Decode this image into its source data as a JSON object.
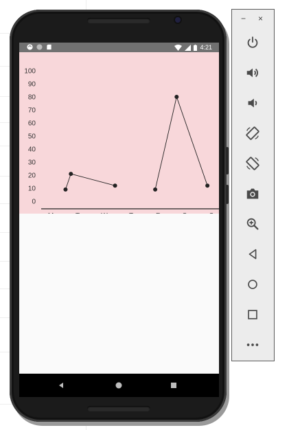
{
  "status_bar": {
    "time": "4:21",
    "left_icons": [
      "sync-icon",
      "circle-icon",
      "sd-card-icon"
    ],
    "right_icons": [
      "wifi-icon",
      "signal-icon",
      "battery-icon"
    ]
  },
  "chart_data": {
    "type": "line",
    "categories": [
      "M",
      "T",
      "W",
      "T",
      "F",
      "S",
      "S"
    ],
    "y_ticks": [
      "0",
      "10",
      "20",
      "30",
      "40",
      "50",
      "60",
      "70",
      "80",
      "90",
      "100"
    ],
    "ylim": [
      0,
      100
    ],
    "segments": [
      [
        [
          0.55,
          9
        ],
        [
          0.75,
          21
        ],
        [
          2.4,
          12
        ]
      ],
      [
        [
          3.9,
          9
        ],
        [
          4.7,
          80
        ],
        [
          5.85,
          12
        ]
      ]
    ],
    "background_color": "#f8d7da",
    "line_color": "#222222"
  },
  "nav_bar": {
    "buttons": [
      "back-icon",
      "home-icon",
      "recents-icon"
    ]
  },
  "emulator_panel": {
    "window_controls": {
      "minimize": "−",
      "close": "×"
    },
    "buttons": [
      "power-icon",
      "volume-up-icon",
      "volume-down-icon",
      "rotate-left-icon",
      "rotate-right-icon",
      "camera-icon",
      "zoom-icon",
      "back-icon",
      "home-icon",
      "overview-icon",
      "more-icon"
    ]
  }
}
